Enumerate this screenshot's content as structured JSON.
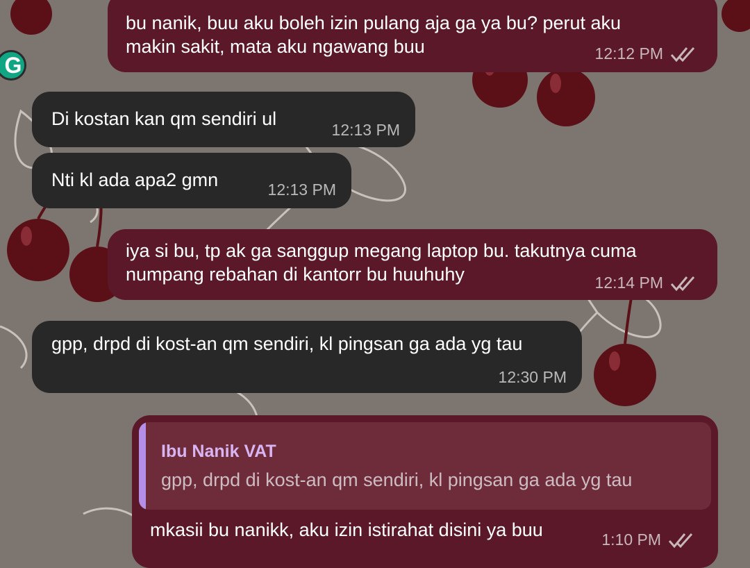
{
  "colors": {
    "wallpaper": "#7d7670",
    "outgoing_bubble": "#5a1828",
    "incoming_bubble": "#282828",
    "cherry": "#5b0f17",
    "quote_accent": "#b58ee8",
    "badge": "#11a683"
  },
  "badge": {
    "letter": "G",
    "icon": "grammarly-icon"
  },
  "messages": [
    {
      "direction": "out",
      "lines": [
        "bu nanik, buu aku boleh izin pulang aja ga ya bu? perut aku",
        "makin sakit, mata aku ngawang buu"
      ],
      "time": "12:12 PM",
      "status": "double-check-icon"
    },
    {
      "direction": "in",
      "lines": [
        "Di kostan kan qm sendiri ul"
      ],
      "time": "12:13 PM"
    },
    {
      "direction": "in",
      "lines": [
        "Nti kl ada apa2 gmn"
      ],
      "time": "12:13 PM"
    },
    {
      "direction": "out",
      "lines": [
        "iya si bu, tp ak ga sanggup megang laptop bu. takutnya cuma",
        "numpang rebahan di kantorr bu huuhuhy"
      ],
      "time": "12:14 PM",
      "status": "double-check-icon"
    },
    {
      "direction": "in",
      "lines": [
        "gpp, drpd di kost-an qm sendiri, kl pingsan ga ada yg tau"
      ],
      "time": "12:30 PM"
    },
    {
      "direction": "out",
      "quote": {
        "author": "Ibu Nanik VAT",
        "text": "gpp, drpd di kost-an qm sendiri, kl pingsan ga ada yg tau"
      },
      "lines": [
        "mkasii bu nanikk, aku izin istirahat disini ya buu"
      ],
      "time": "1:10 PM",
      "status": "double-check-icon"
    }
  ]
}
